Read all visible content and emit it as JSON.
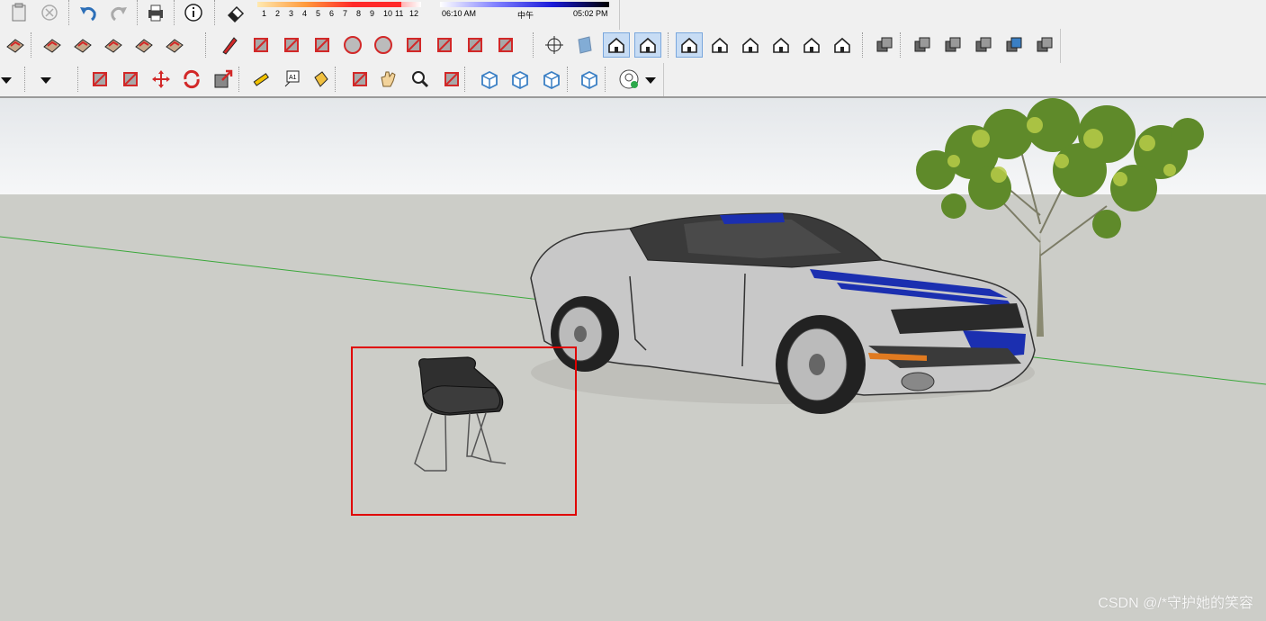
{
  "toolbar": {
    "shadow_months": [
      "1",
      "2",
      "3",
      "4",
      "5",
      "6",
      "7",
      "8",
      "9",
      "10",
      "11",
      "12"
    ],
    "shadow_time_start": "06:10 AM",
    "shadow_time_mid": "中午",
    "shadow_time_end": "05:02 PM",
    "row1_icons": [
      "paste-icon",
      "close-icon",
      "undo-icon",
      "redo-icon",
      "print-icon",
      "model-info-icon",
      "eraser-icon"
    ],
    "row2_icons": [
      "sandbox-grid-icon",
      "sandbox-smoove-icon",
      "sandbox-stamp-icon",
      "sandbox-drape-icon",
      "sandbox-add-detail-icon",
      "sandbox-flip-edge-icon",
      "pencil-icon",
      "freehand-icon",
      "rectangle-icon",
      "rotated-rectangle-icon",
      "circle-icon",
      "polygon-icon",
      "arc-icon",
      "arc-2pt-icon",
      "arc-3pt-icon",
      "pie-icon",
      "orbit-center-icon",
      "section-plane-icon",
      "iso-view-icon",
      "standard-view-icon",
      "top-view-icon",
      "front-view-icon",
      "right-view-icon",
      "back-view-icon",
      "left-view-icon",
      "bottom-view-icon",
      "xray-icon",
      "wireframe-icon",
      "hidden-line-icon",
      "shaded-icon",
      "shaded-texture-icon",
      "monochrome-icon"
    ],
    "row3_icons": [
      "select-dropdown-icon",
      "eraser-dropdown-icon",
      "push-pull-icon",
      "follow-me-icon",
      "move-icon",
      "rotate-icon",
      "scale-icon",
      "tape-measure-icon",
      "text-icon",
      "paint-bucket-icon",
      "orbit-icon",
      "pan-icon",
      "zoom-icon",
      "zoom-extents-icon",
      "warehouse-icon",
      "extension-warehouse-icon",
      "layout-icon",
      "extension-manager-icon",
      "account-icon",
      "account-dropdown-icon"
    ]
  },
  "scene": {
    "objects": [
      "car",
      "tree",
      "chair"
    ],
    "selection": "chair"
  },
  "watermark": "CSDN @/*守护她的笑容",
  "colors": {
    "toolbar_bg": "#f0f0f0",
    "sky": "#eef0f2",
    "ground": "#cccdc8",
    "selection": "#e00000",
    "axis_green": "#3aa83a",
    "car_body": "#c8c8c8",
    "car_stripe": "#1b2fb0",
    "icon_red": "#d22828",
    "icon_blue": "#3a7fc4"
  }
}
